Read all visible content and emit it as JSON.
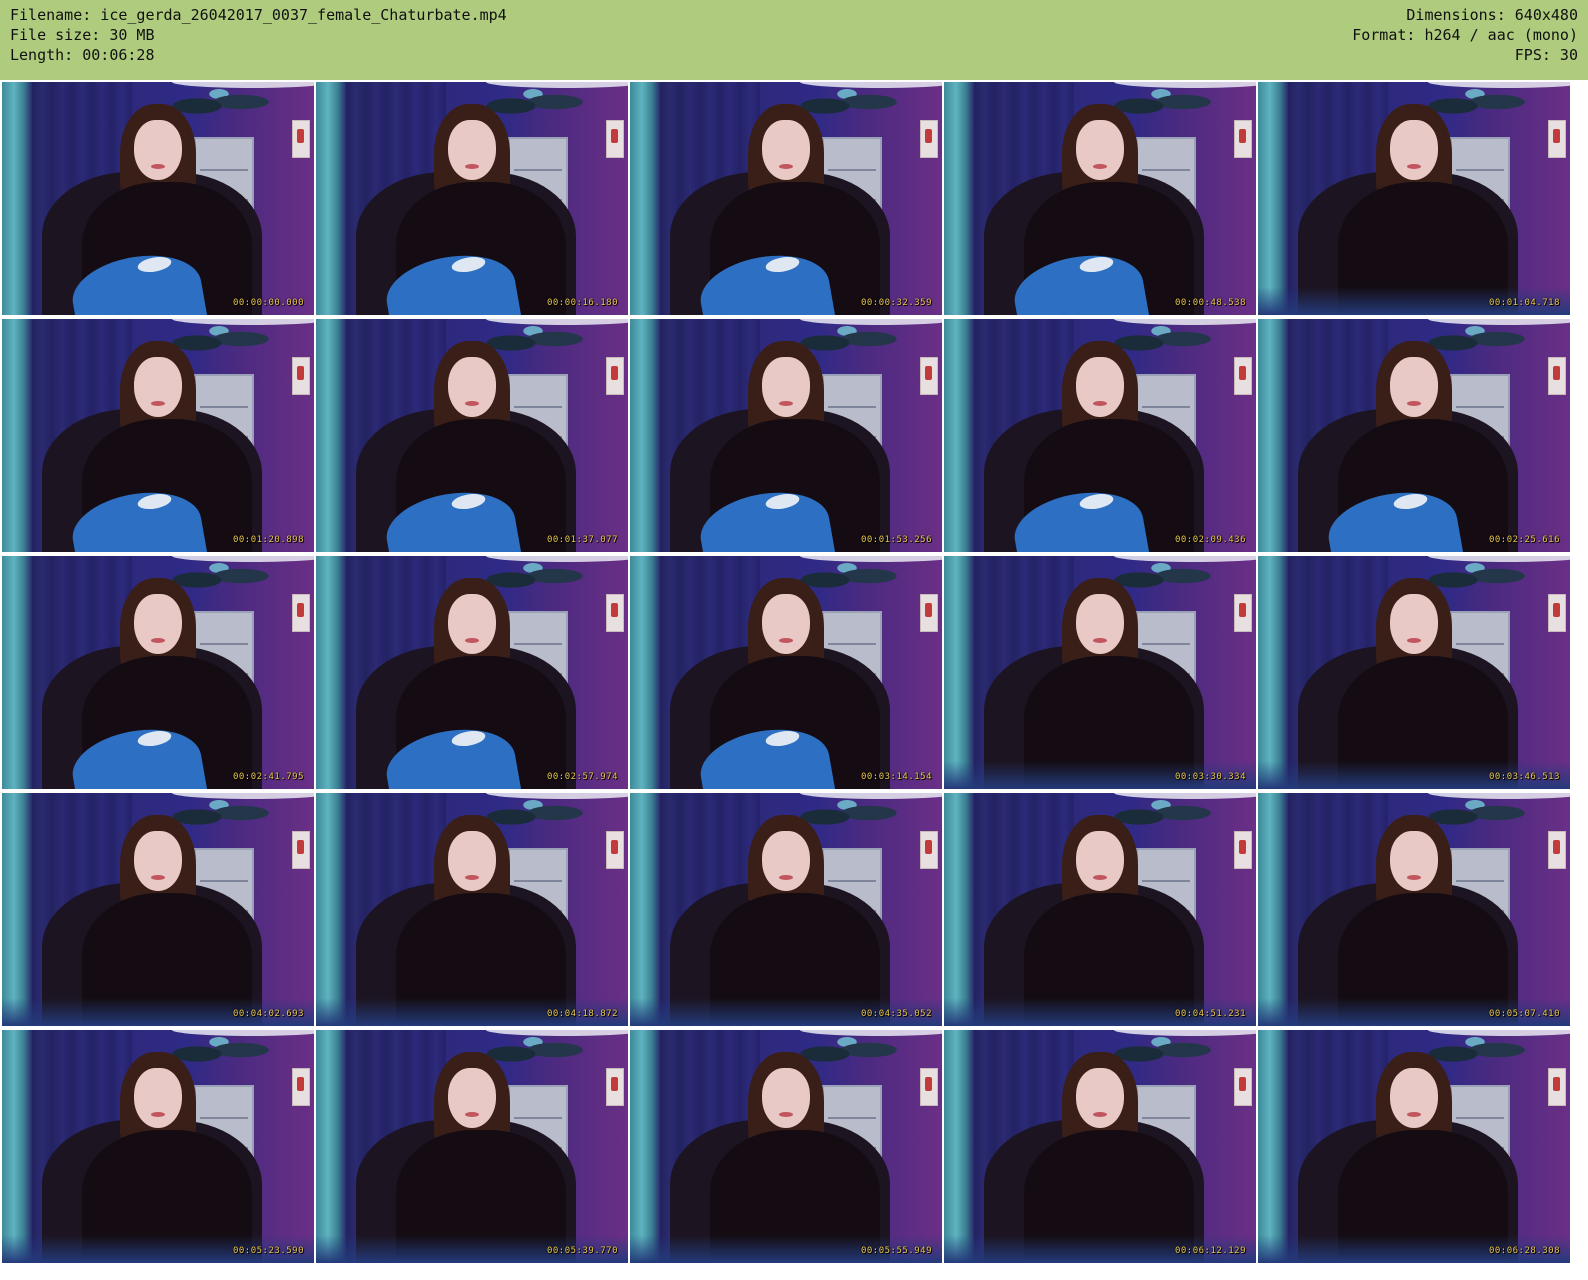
{
  "header": {
    "left_lines": [
      "Filename: ice_gerda_26042017_0037_female_Chaturbate.mp4",
      "File size: 30 MB",
      "Length: 00:06:28"
    ],
    "right_lines": [
      "Dimensions: 640x480",
      "Format: h264 / aac (mono)",
      "FPS: 30"
    ],
    "background_color": "#aecb7e"
  },
  "thumbnails": [
    {
      "timestamp": "00:00:00.000",
      "jeans_visible": true
    },
    {
      "timestamp": "00:00:16.180",
      "jeans_visible": true
    },
    {
      "timestamp": "00:00:32.359",
      "jeans_visible": true
    },
    {
      "timestamp": "00:00:48.538",
      "jeans_visible": true
    },
    {
      "timestamp": "00:01:04.718",
      "jeans_visible": false
    },
    {
      "timestamp": "00:01:20.898",
      "jeans_visible": true
    },
    {
      "timestamp": "00:01:37.077",
      "jeans_visible": true
    },
    {
      "timestamp": "00:01:53.256",
      "jeans_visible": true
    },
    {
      "timestamp": "00:02:09.436",
      "jeans_visible": true
    },
    {
      "timestamp": "00:02:25.616",
      "jeans_visible": true
    },
    {
      "timestamp": "00:02:41.795",
      "jeans_visible": true
    },
    {
      "timestamp": "00:02:57.974",
      "jeans_visible": true
    },
    {
      "timestamp": "00:03:14.154",
      "jeans_visible": true
    },
    {
      "timestamp": "00:03:30.334",
      "jeans_visible": false
    },
    {
      "timestamp": "00:03:46.513",
      "jeans_visible": false
    },
    {
      "timestamp": "00:04:02.693",
      "jeans_visible": false
    },
    {
      "timestamp": "00:04:18.872",
      "jeans_visible": false
    },
    {
      "timestamp": "00:04:35.052",
      "jeans_visible": false
    },
    {
      "timestamp": "00:04:51.231",
      "jeans_visible": false
    },
    {
      "timestamp": "00:05:07.410",
      "jeans_visible": false
    },
    {
      "timestamp": "00:05:23.590",
      "jeans_visible": false
    },
    {
      "timestamp": "00:05:39.770",
      "jeans_visible": false
    },
    {
      "timestamp": "00:05:55.949",
      "jeans_visible": false
    },
    {
      "timestamp": "00:06:12.129",
      "jeans_visible": false
    },
    {
      "timestamp": "00:06:28.308",
      "jeans_visible": false
    }
  ],
  "colors": {
    "timestamp_text": "#e8c64a",
    "sweater": "#140c12",
    "jeans": "#2d6fc3",
    "curtain": "#2f2a86"
  }
}
